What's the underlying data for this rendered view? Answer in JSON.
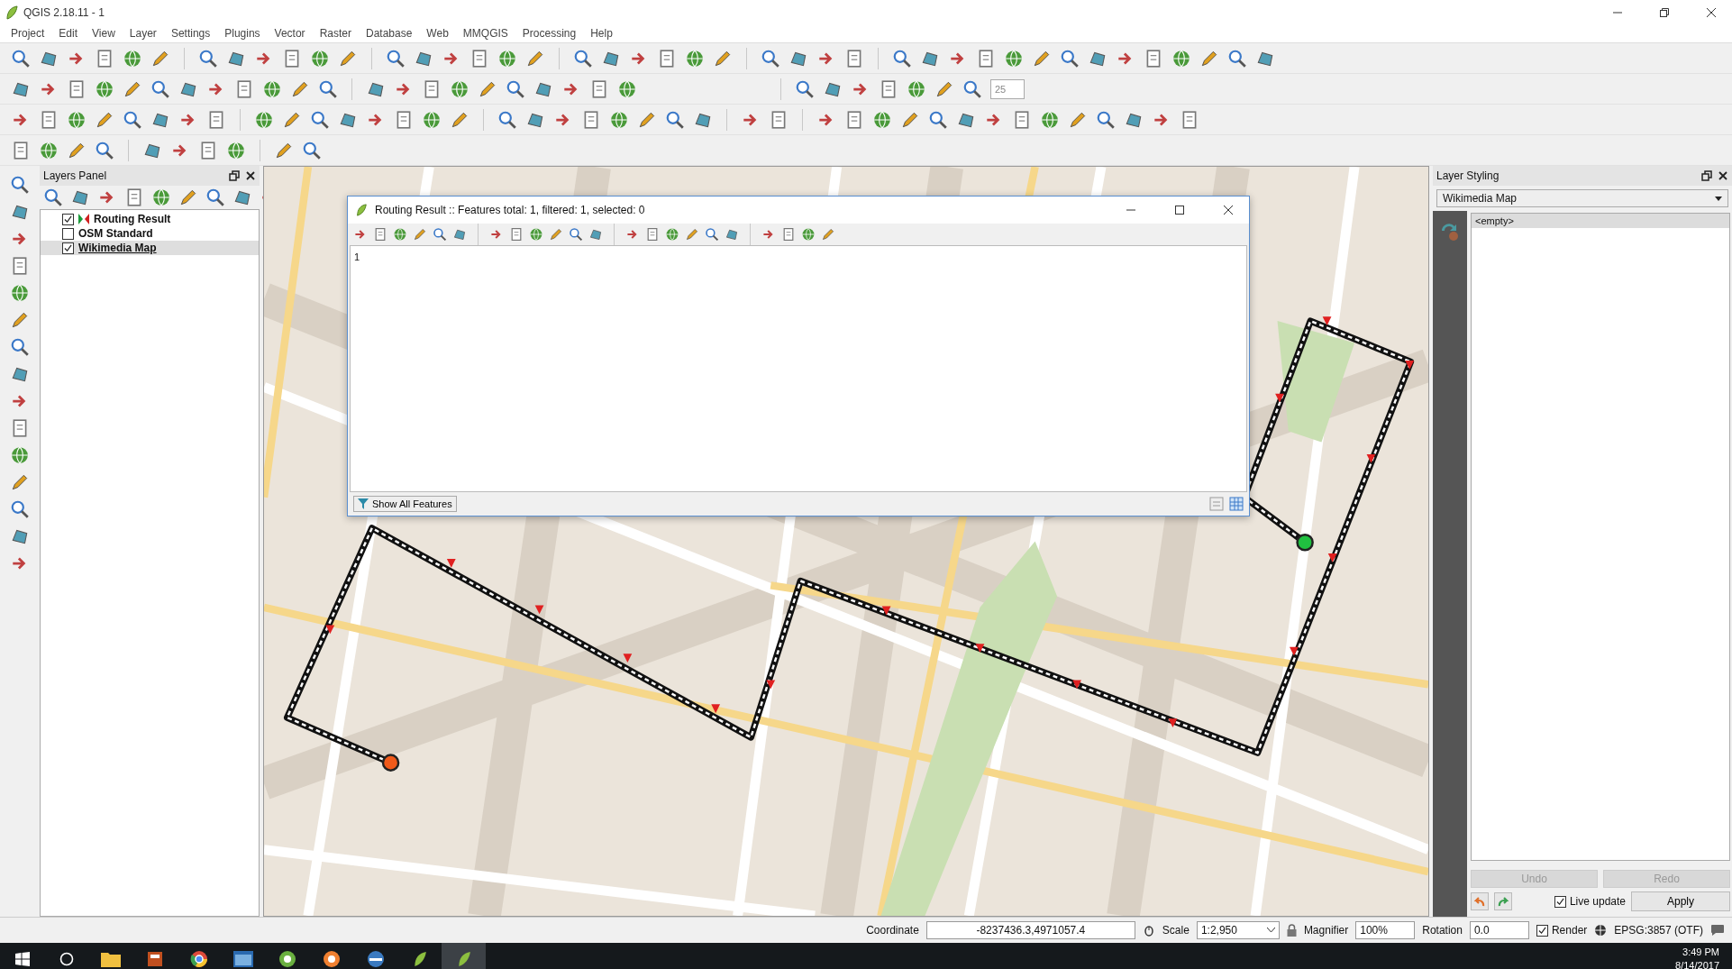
{
  "window": {
    "title": "QGIS 2.18.11 - 1"
  },
  "menu": [
    "Project",
    "Edit",
    "View",
    "Layer",
    "Settings",
    "Plugins",
    "Vector",
    "Raster",
    "Database",
    "Web",
    "MMQGIS",
    "Processing",
    "Help"
  ],
  "toolbar": {
    "spin_value": "25"
  },
  "layers_panel": {
    "title": "Layers Panel",
    "layers": [
      {
        "name": "Routing Result",
        "checked": true,
        "selected": false
      },
      {
        "name": "OSM Standard",
        "checked": false,
        "selected": false
      },
      {
        "name": "Wikimedia Map",
        "checked": true,
        "selected": true
      }
    ]
  },
  "attribute_table": {
    "title": "Routing Result :: Features total: 1, filtered: 1, selected: 0",
    "rows": [
      "1"
    ],
    "filter_button": "Show All Features"
  },
  "layer_styling": {
    "title": "Layer Styling",
    "layer": "Wikimedia Map",
    "list": [
      {
        "label": "<empty>",
        "selected": true
      }
    ],
    "undo": {
      "label": "Undo",
      "disabled": true
    },
    "redo": {
      "label": "Redo",
      "disabled": true
    },
    "live_update": {
      "label": "Live update",
      "checked": true
    },
    "apply": "Apply"
  },
  "status_bar": {
    "coordinate_label": "Coordinate",
    "coordinate": "-8237436.3,4971057.4",
    "scale_label": "Scale",
    "scale": "1:2,950",
    "magnifier_label": "Magnifier",
    "magnifier": "100%",
    "rotation_label": "Rotation",
    "rotation": "0.0",
    "render": {
      "label": "Render",
      "checked": true
    },
    "crs": "EPSG:3857 (OTF)"
  },
  "taskbar": {
    "time": "3:49 PM",
    "date": "8/14/2017"
  }
}
